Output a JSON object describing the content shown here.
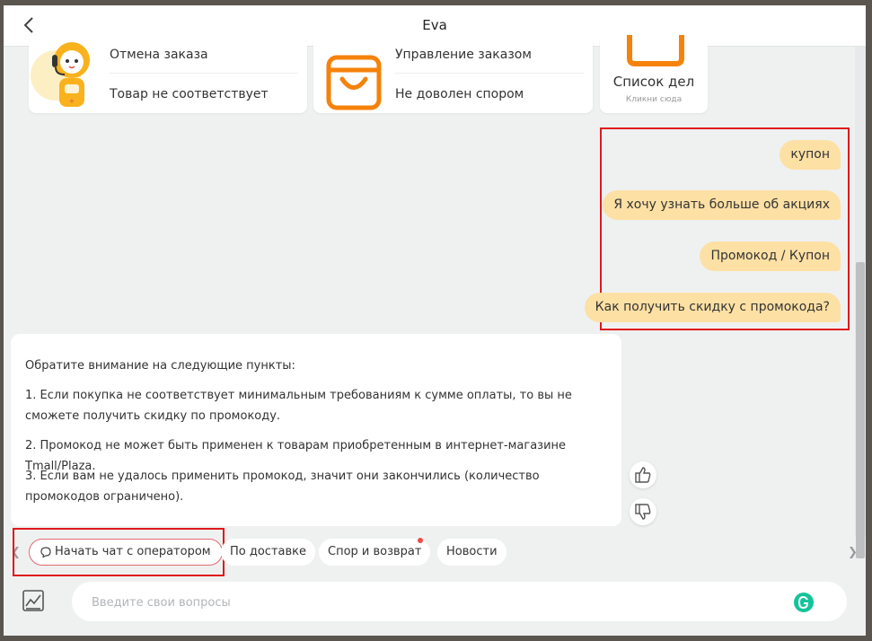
{
  "header": {
    "title": "Eva"
  },
  "cards": {
    "card1": {
      "link_a": "Отмена заказа",
      "link_b": "Товар не соответствует"
    },
    "card2": {
      "link_a": "Управление заказом",
      "link_b": "Не доволен спором"
    },
    "card3": {
      "title": "Список дел",
      "subtitle": "Кликни сюда"
    }
  },
  "user_messages": [
    "купон",
    "Я хочу узнать больше об акциях",
    "Промокод / Купон",
    "Как получить скидку с промокода?"
  ],
  "bot_answer": {
    "intro": "Обратите внимание на следующие пункты:",
    "p1": "1. Если покупка не соответствует минимальным требованиям к сумме оплаты, то вы не сможете получить скидку по промокоду.",
    "p2": "2. Промокод не может быть применен к товарам приобретенным в интернет-магазине Tmall/Plaza.",
    "p3": "3. Если вам не удалось применить промокод, значит они закончились (количество промокодов ограничено)."
  },
  "quick_replies": {
    "operator": "Начать чат с оператором",
    "delivery": "По доставке",
    "dispute": "Спор и возврат",
    "news": "Новости"
  },
  "input": {
    "placeholder": "Введите свои вопросы"
  },
  "colors": {
    "accent_orange": "#f5820a",
    "user_bubble": "#fde0a4",
    "highlight": "#e0181b",
    "notification_dot": "#f04b4b",
    "grammarly": "#15c39a"
  }
}
